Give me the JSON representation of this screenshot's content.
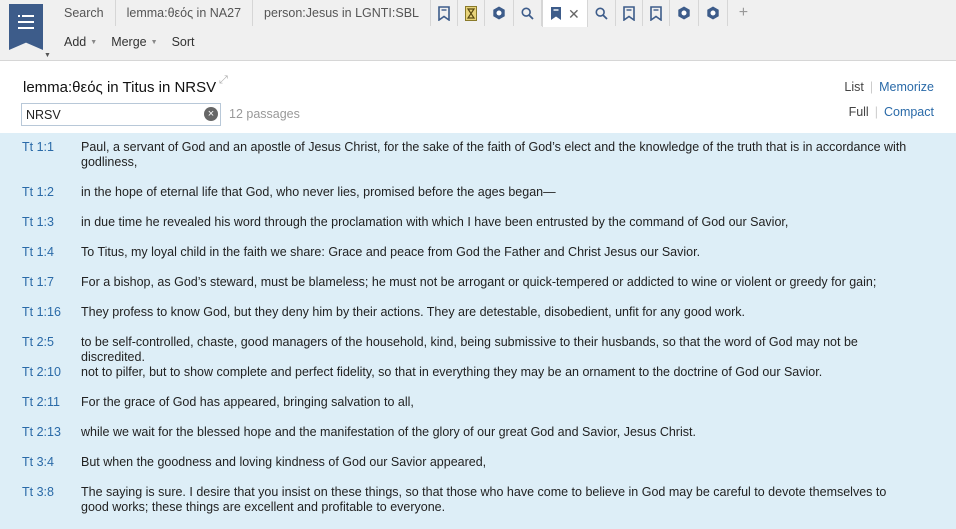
{
  "tabs": [
    {
      "label": "Search",
      "icon": null
    },
    {
      "label": "lemma:θεός in NA27",
      "icon": null
    },
    {
      "label": "person:Jesus in LGNTI:SBL",
      "icon": null
    },
    {
      "label": "",
      "icon": "bookmark-icon"
    },
    {
      "label": "",
      "icon": "hourglass-icon"
    },
    {
      "label": "",
      "icon": "hexagon-icon"
    },
    {
      "label": "",
      "icon": "search-icon"
    },
    {
      "label": "",
      "icon": "bookmark-icon",
      "active": true
    },
    {
      "label": "",
      "icon": "search-icon"
    },
    {
      "label": "",
      "icon": "bookmark-icon"
    },
    {
      "label": "",
      "icon": "bookmark-icon"
    },
    {
      "label": "",
      "icon": "hexagon-icon"
    },
    {
      "label": "",
      "icon": "hexagon-icon"
    }
  ],
  "add_tab": "+",
  "close_symbol": "✕",
  "toolbar": {
    "add": "Add",
    "merge": "Merge",
    "sort": "Sort"
  },
  "header": {
    "title": "lemma:θεός in Titus in NRSV",
    "list": "List",
    "memorize": "Memorize",
    "full": "Full",
    "compact": "Compact"
  },
  "filter": {
    "value": "NRSV",
    "count": "12 passages"
  },
  "colors": {
    "accent": "#3d5c8a",
    "link": "#2a6aa8",
    "results_bg": "#ddeef7"
  },
  "results": [
    {
      "ref": "Tt 1:1",
      "text": "Paul, a servant of God and an apostle of Jesus Christ, for the sake of the faith of God’s elect and the knowledge of the truth that is in accordance with godliness,"
    },
    {
      "ref": "Tt 1:2",
      "text": "in the hope of eternal life that God, who never lies, promised before the ages began—"
    },
    {
      "ref": "Tt 1:3",
      "text": "in due time he revealed his word through the proclamation with which I have been entrusted by the command of God our Savior,"
    },
    {
      "ref": "Tt 1:4",
      "text": "To Titus, my loyal child in the faith we share: Grace and peace from God the Father and Christ Jesus our Savior."
    },
    {
      "ref": "Tt 1:7",
      "text": "For a bishop, as God’s steward, must be blameless; he must not be arrogant or quick-tempered or addicted to wine or violent or greedy for gain;"
    },
    {
      "ref": "Tt 1:16",
      "text": "They profess to know God, but they deny him by their actions. They are detestable, disobedient, unfit for any good work."
    },
    {
      "ref": "Tt 2:5",
      "text": "to be self-controlled, chaste, good managers of the household, kind, being submissive to their husbands, so that the word of God may not be discredited."
    },
    {
      "ref": "Tt 2:10",
      "text": "not to pilfer, but to show complete and perfect fidelity, so that in everything they may be an ornament to the doctrine of God our Savior."
    },
    {
      "ref": "Tt 2:11",
      "text": "For the grace of God has appeared, bringing salvation to all,"
    },
    {
      "ref": "Tt 2:13",
      "text": "while we wait for the blessed hope and the manifestation of the glory of our great God and Savior, Jesus Christ."
    },
    {
      "ref": "Tt 3:4",
      "text": "But when the goodness and loving kindness of God our Savior appeared,"
    },
    {
      "ref": "Tt 3:8",
      "text": "The saying is sure. I desire that you insist on these things, so that those who have come to believe in God may be careful to devote themselves to good works; these things are excellent and profitable to everyone."
    }
  ]
}
